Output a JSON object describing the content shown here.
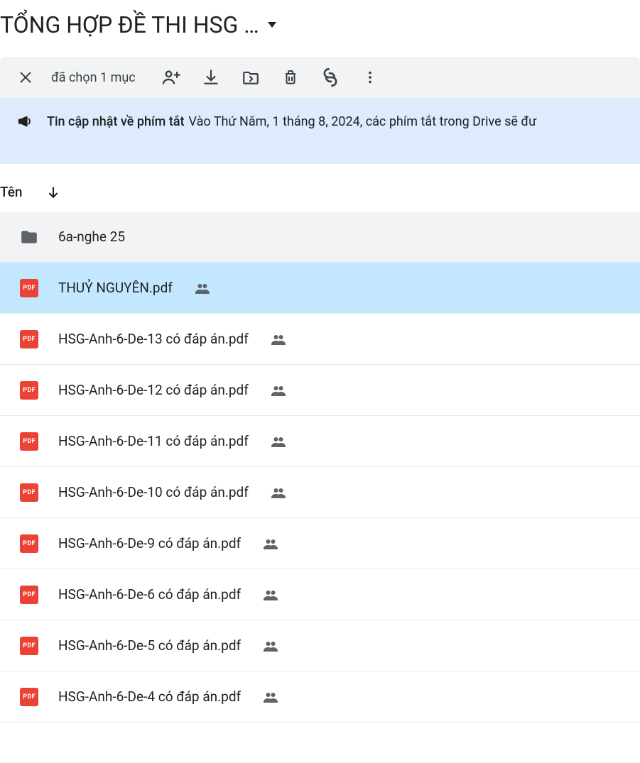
{
  "header": {
    "title": "TỔNG HỢP ĐỀ THI HSG …"
  },
  "actionBar": {
    "selection_label": "đã chọn 1 mục"
  },
  "banner": {
    "title": "Tin cập nhật về phím tắt",
    "body": "Vào Thứ Năm, 1 tháng 8, 2024, các phím tắt trong Drive sẽ đư"
  },
  "listHeader": {
    "name_col": "Tên"
  },
  "files": [
    {
      "name": "6a-nghe 25",
      "type": "folder",
      "shared": false,
      "state": "hover"
    },
    {
      "name": "THUỶ NGUYÊN.pdf",
      "type": "pdf",
      "shared": true,
      "state": "selected"
    },
    {
      "name": "HSG-Anh-6-De-13 có đáp án.pdf",
      "type": "pdf",
      "shared": true,
      "state": "none"
    },
    {
      "name": "HSG-Anh-6-De-12 có đáp án.pdf",
      "type": "pdf",
      "shared": true,
      "state": "none"
    },
    {
      "name": "HSG-Anh-6-De-11 có đáp án.pdf",
      "type": "pdf",
      "shared": true,
      "state": "none"
    },
    {
      "name": "HSG-Anh-6-De-10 có đáp án.pdf",
      "type": "pdf",
      "shared": true,
      "state": "none"
    },
    {
      "name": "HSG-Anh-6-De-9 có đáp án.pdf",
      "type": "pdf",
      "shared": true,
      "state": "none"
    },
    {
      "name": "HSG-Anh-6-De-6 có đáp án.pdf",
      "type": "pdf",
      "shared": true,
      "state": "none"
    },
    {
      "name": "HSG-Anh-6-De-5 có đáp án.pdf",
      "type": "pdf",
      "shared": true,
      "state": "none"
    },
    {
      "name": "HSG-Anh-6-De-4 có đáp án.pdf",
      "type": "pdf",
      "shared": true,
      "state": "none"
    }
  ]
}
